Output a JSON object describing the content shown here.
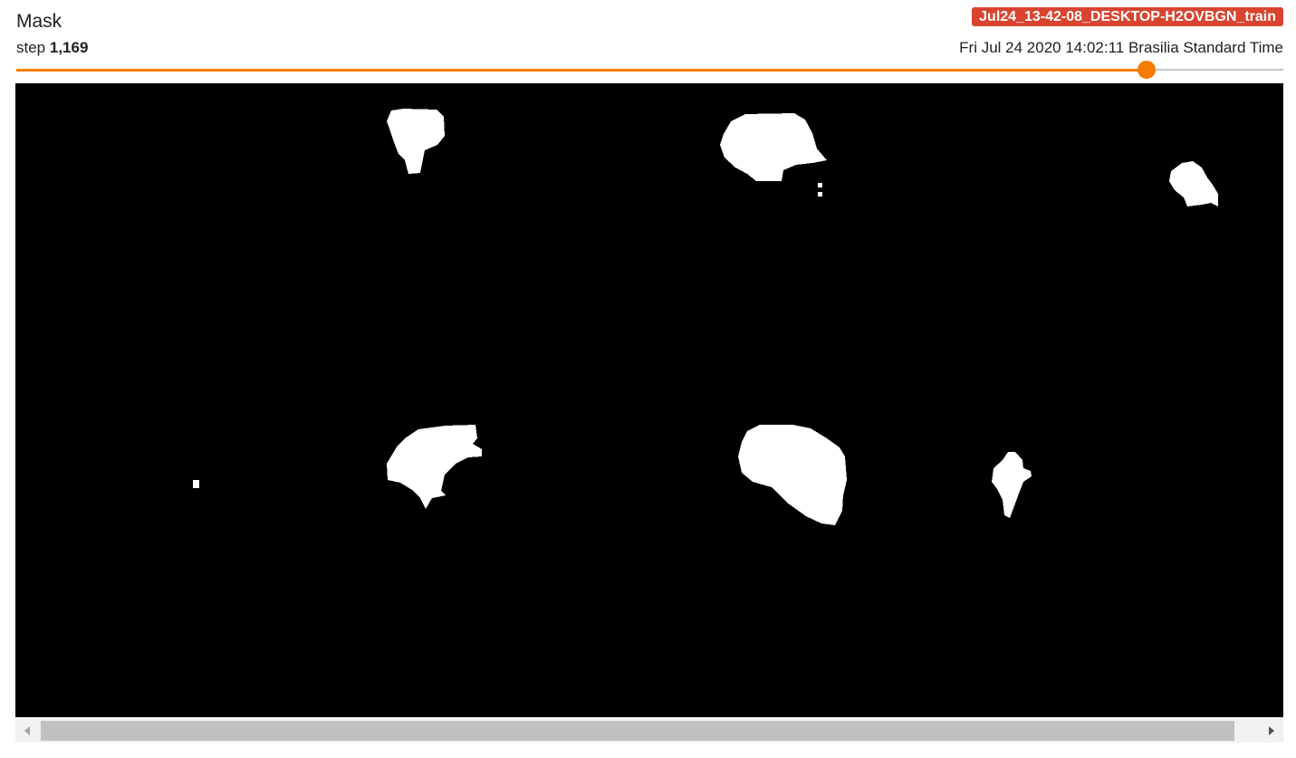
{
  "card": {
    "title": "Mask",
    "step_prefix": "step",
    "step_value": "1,169",
    "run": "Jul24_13-42-08_DESKTOP-H2OVBGN_train",
    "timestamp": "Fri Jul 24 2020 14:02:11 Brasilia Standard Time"
  },
  "slider": {
    "position_fraction": 0.892
  },
  "colors": {
    "accent": "#f57c00",
    "run_badge": "#d9432f",
    "mask_background": "#000000",
    "mask_foreground": "#ffffff"
  },
  "icons": {
    "scroll_left": "chevron-left-icon",
    "scroll_right": "chevron-right-icon"
  }
}
